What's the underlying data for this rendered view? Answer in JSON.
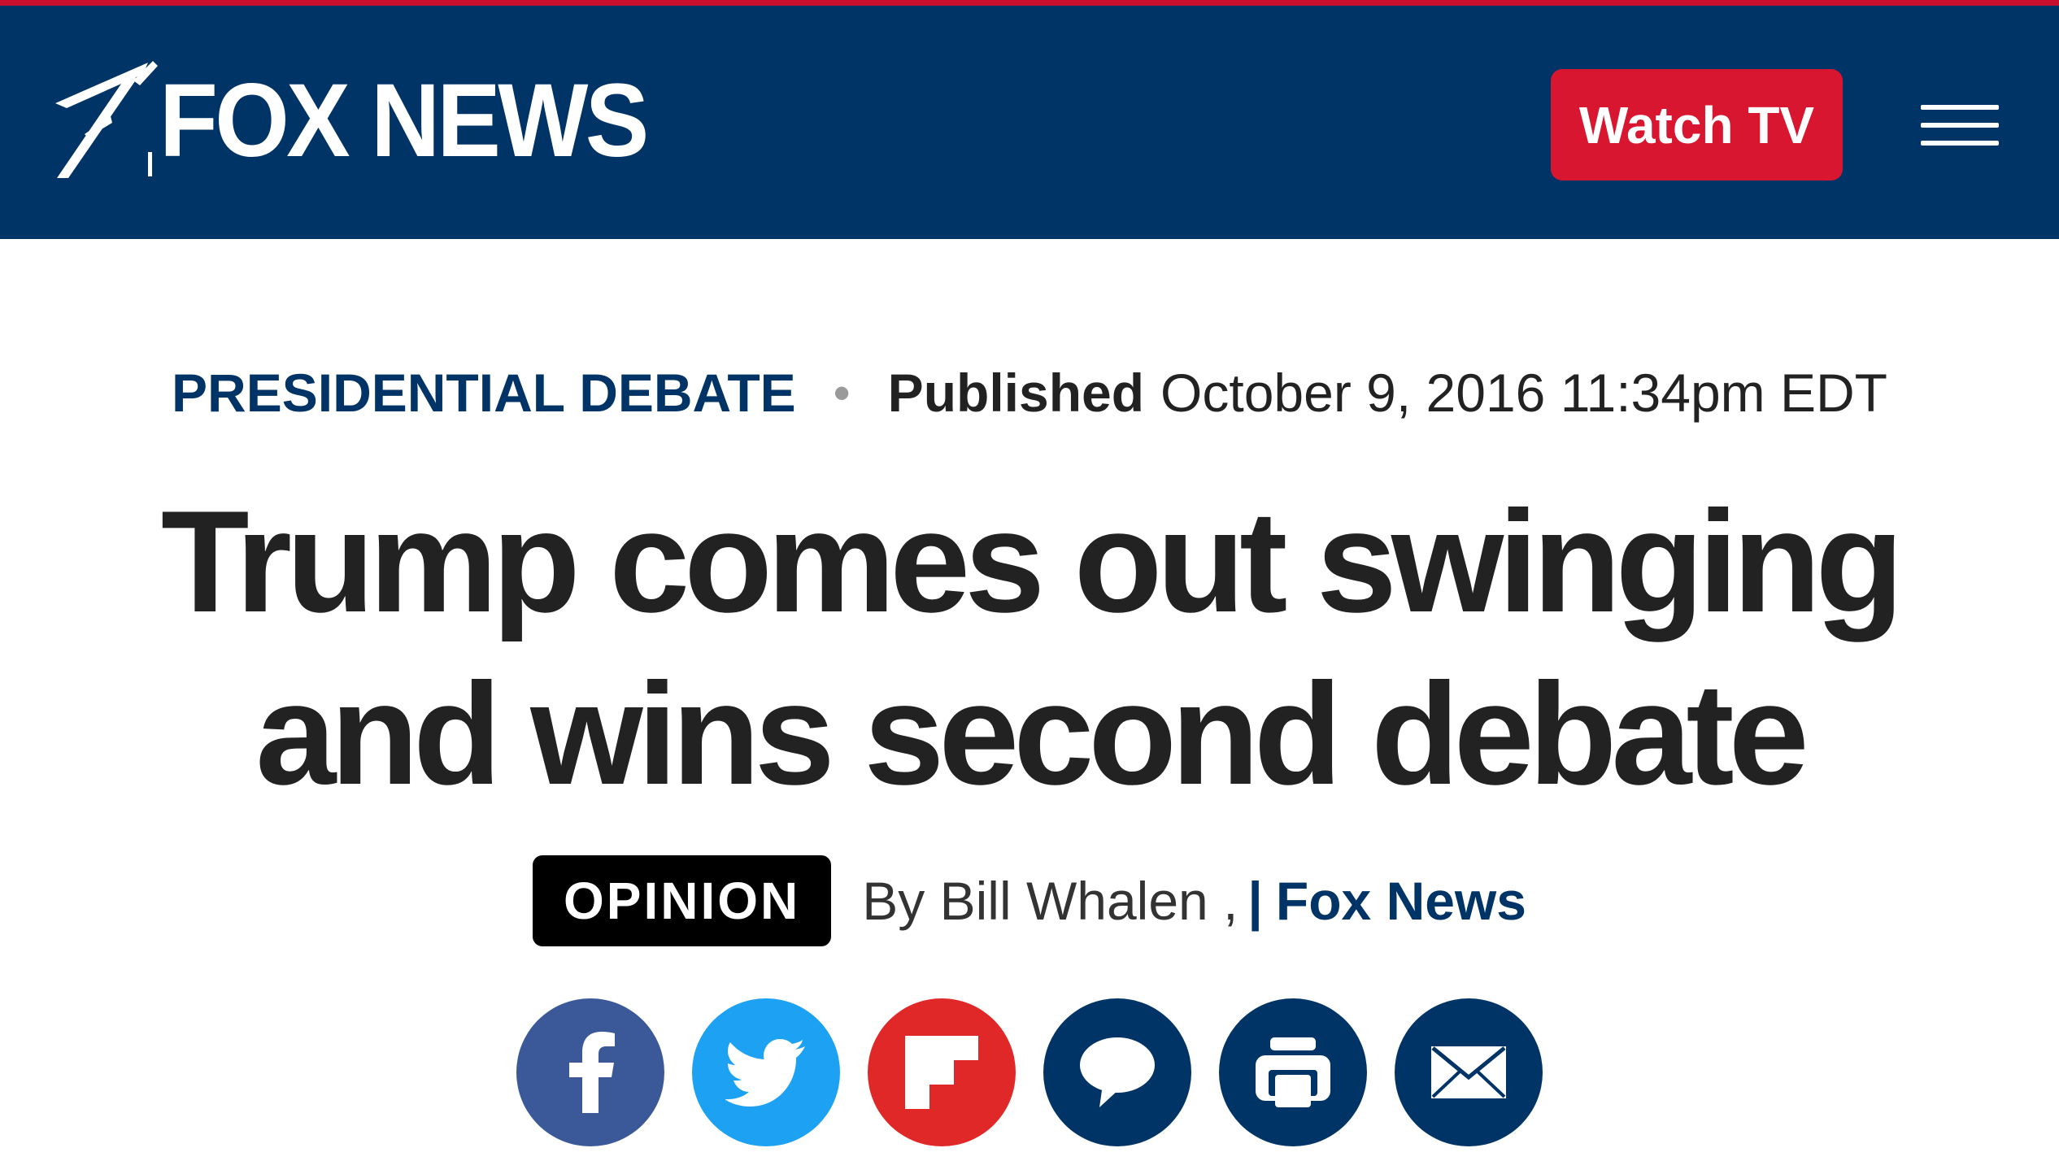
{
  "header": {
    "logo_text": "FOX NEWS",
    "watch_tv_label": "Watch TV",
    "colors": {
      "navy": "#003366",
      "red_stripe": "#c8102e",
      "watch_button": "#d8162f"
    }
  },
  "article": {
    "category": "PRESIDENTIAL DEBATE",
    "separator": "•",
    "published_label": "Published",
    "published_date": "October 9, 2016 11:34pm EDT",
    "headline": "Trump comes out swinging and wins second debate",
    "opinion_badge": "OPINION",
    "byline": "By Bill Whalen ,",
    "byline_separator": "|",
    "source": "Fox News"
  },
  "share": {
    "buttons": [
      {
        "icon": "facebook-icon",
        "color": "#3b5998"
      },
      {
        "icon": "twitter-icon",
        "color": "#1da1f2"
      },
      {
        "icon": "flipboard-icon",
        "color": "#e12828"
      },
      {
        "icon": "comment-icon",
        "color": "#003366"
      },
      {
        "icon": "print-icon",
        "color": "#003366"
      },
      {
        "icon": "email-icon",
        "color": "#003366"
      }
    ]
  }
}
